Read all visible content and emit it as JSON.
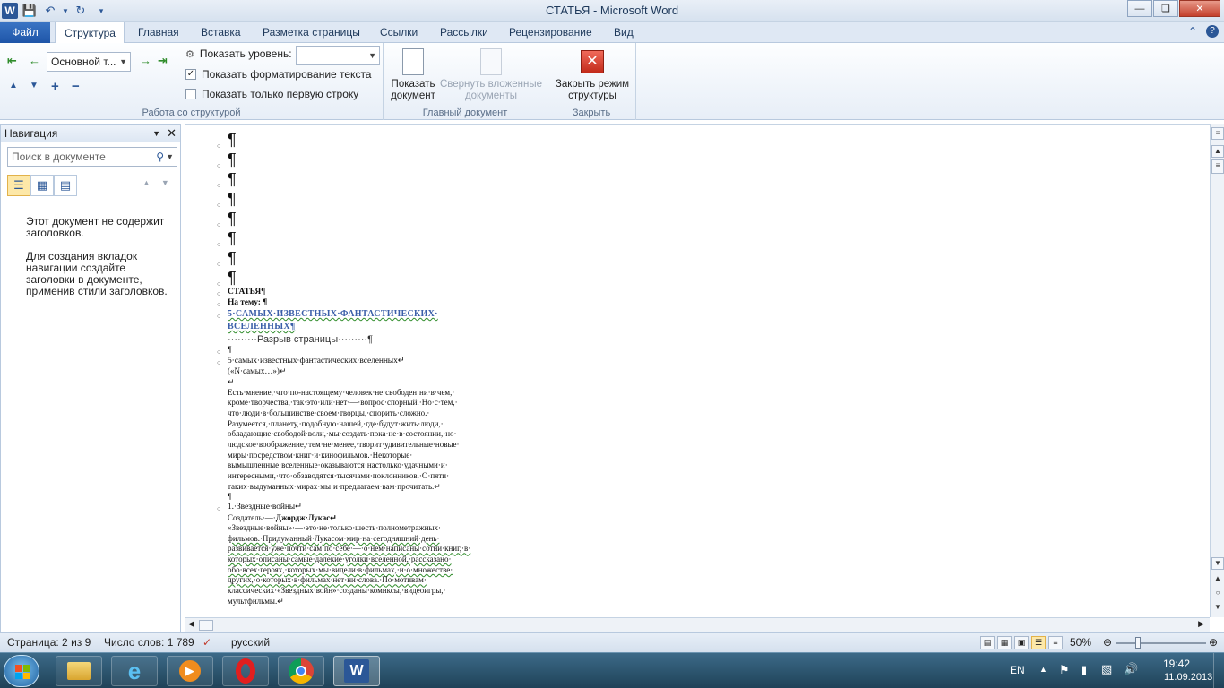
{
  "window": {
    "title": "СТАТЬЯ - Microsoft Word",
    "app_icon": "W",
    "controls": [
      "minimize-icon",
      "maximize-icon",
      "close-icon"
    ]
  },
  "tabs": [
    "Файл",
    "Структура",
    "Главная",
    "Вставка",
    "Разметка страницы",
    "Ссылки",
    "Рассылки",
    "Рецензирование",
    "Вид"
  ],
  "ribbon": {
    "outline_group": {
      "level_combo_value": "Основной т...",
      "show_level_label": "Показать уровень:",
      "show_level_value": "",
      "show_formatting_label": "Показать форматирование текста",
      "show_formatting_checked": true,
      "first_line_only_label": "Показать только первую строку",
      "first_line_only_checked": false,
      "label": "Работа со структурой"
    },
    "master_group": {
      "show_document_label": "Показать документ",
      "collapse_subdocs_label": "Свернуть вложенные документы",
      "label": "Главный документ"
    },
    "close_group": {
      "close_outline_label": "Закрыть режим структуры",
      "label": "Закрыть"
    }
  },
  "nav_pane": {
    "title": "Навигация",
    "search_placeholder": "Поиск в документе",
    "message1": "Этот документ не содержит заголовков.",
    "message2": "Для создания вкладок навигации создайте заголовки в документе, применив стили заголовков."
  },
  "document": {
    "pilcrow": "¶",
    "empty_levels": 8,
    "lines": [
      "СТАТЬЯ¶",
      "На тему: ¶"
    ],
    "heading1": "5·САМЫХ·ИЗВЕСТНЫХ·ФАНТАСТИЧЕСКИХ·",
    "heading2": "ВСЕЛЕННЫХ¶",
    "page_break": "·········Разрыв страницы·········¶",
    "empty_para": "¶",
    "title_line1": "5·самых·известных·фантастических·вселенных↵",
    "title_line2": "(«N·самых…»)↵",
    "return_line": "↵",
    "para1": [
      "Есть·мнение,·что·по-настоящему·человек·не·свободен·ни·в·чем,·",
      "кроме·творчества,·так·это·или·нет·—·вопрос·спорный.·Но·с·тем,·",
      "что·люди·в·большинстве·своем·творцы,·спорить·сложно.·",
      "Разумеется,·планету,·подобную·нашей,·где·будут·жить·люди,·",
      "обладающие·свободой·воли,·мы·создать·пока·не·в·состоянии,·но·",
      "людское·воображение,·тем·не·менее,·творит·удивительные·новые·",
      "миры·посредством·книг·и·кинофильмов.·Некоторые·",
      "вымышленные·вселенные·оказываются·настолько·удачными·и·",
      "интересными,·что·обзаводятся·тысячами·поклонников.·О·пяти·",
      "таких·выдуманных·мирах·мы·и·предлагаем·вам·прочитать.↵"
    ],
    "empty_para2": "¶",
    "section_title": "1.·Звездные·войны↵",
    "creator_prefix": "Создатель·—·",
    "creator_name": "Джордж·Лукас↵",
    "para2": [
      "«Звездные·войны»·—·это·не·только·шесть·полнометражных·",
      "фильмов.·Придуманный·Лукасом·мир·на·сегодняшний·день·",
      "развивается·уже·почти·сам·по·себе·—·о·нем·написаны·сотни·книг,·в·",
      "которых·описаны·самые·далекие·уголки·вселенной,·рассказано·",
      "обо·всех·героях,·которых·мы·видели·в·фильмах,·и·о·множестве·",
      "других,·о·которых·в·фильмах·нет·ни·слова.·По·мотивам·",
      "классических·«Звездных·войн»·созданы·комиксы,·видеоигры,·",
      "мультфильмы.↵"
    ]
  },
  "status_bar": {
    "page": "Страница: 2 из 9",
    "words": "Число слов: 1 789",
    "language": "русский",
    "zoom": "50%",
    "zoom_fraction": 0.5
  },
  "taskbar": {
    "apps": [
      "explorer-icon",
      "ie-icon",
      "media-player-icon",
      "opera-icon",
      "chrome-icon",
      "word-icon"
    ],
    "lang": "EN",
    "time": "19:42",
    "date": "11.09.2013"
  }
}
